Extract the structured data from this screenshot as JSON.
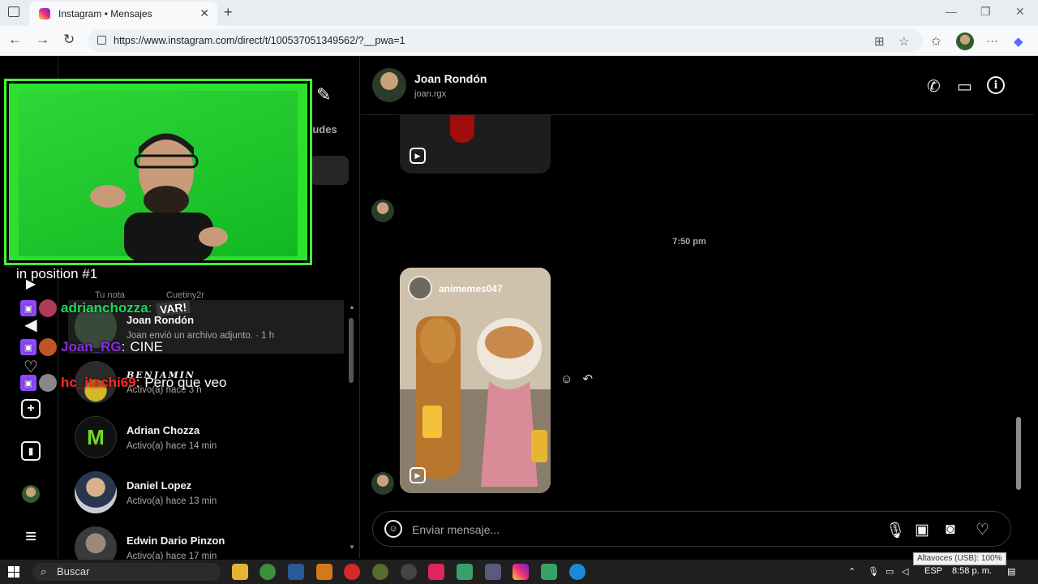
{
  "browser": {
    "tab_title": "Instagram • Mensajes",
    "url": "https://www.instagram.com/direct/t/100537051349562/?__pwa=1"
  },
  "inbox": {
    "requests_label": "tudes",
    "notes": [
      {
        "label": "Tu nota"
      },
      {
        "label": "Cuetiny2r"
      }
    ],
    "conversations": [
      {
        "name": "Joan Rondón",
        "sub": "Joan envió un archivo adjunto. · 1 h",
        "avatar_color": "#3a4a3a",
        "active": true
      },
      {
        "name": "BENJAMIN",
        "sub": "Activo(a) hace 3 h",
        "avatar_color": "#6b5a2a",
        "active": false
      },
      {
        "name": "Adrian Chozza",
        "sub": "Activo(a) hace 14 min",
        "avatar_color": "#111111",
        "active": false
      },
      {
        "name": "Daniel Lopez",
        "sub": "Activo(a) hace 13 min",
        "avatar_color": "#c8ccd4",
        "active": false
      },
      {
        "name": "Edwin Dario Pinzon",
        "sub": "Activo(a) hace 17 min",
        "avatar_color": "#444444",
        "active": false
      }
    ]
  },
  "chat": {
    "contact_name": "Joan Rondón",
    "contact_username": "joan.rgx",
    "emoji_message": "😂",
    "timestamp": "7:50 pm",
    "reel_user": "animemes047",
    "composer_placeholder": "Enviar mensaje..."
  },
  "stream_overlay": {
    "position_text": "in position #1",
    "chat_messages": [
      {
        "user": "adrianchozza",
        "message": "VAR!",
        "user_color": "#1ed760"
      },
      {
        "user": "Joan_RG",
        "message": "CINE",
        "user_color": "#8a2be2"
      },
      {
        "user": "hc_itachi69",
        "message": "Pero que veo",
        "user_color": "#ff2a2a"
      }
    ]
  },
  "taskbar": {
    "search_label": "Buscar",
    "language": "ESP",
    "clock": "8:58 p. m.",
    "volume_tooltip": "Altavoces (USB): 100%"
  },
  "colors": {
    "instagram_bg": "#000000",
    "accent_green": "#43ff3a",
    "twitch_purple": "#9146ff"
  }
}
